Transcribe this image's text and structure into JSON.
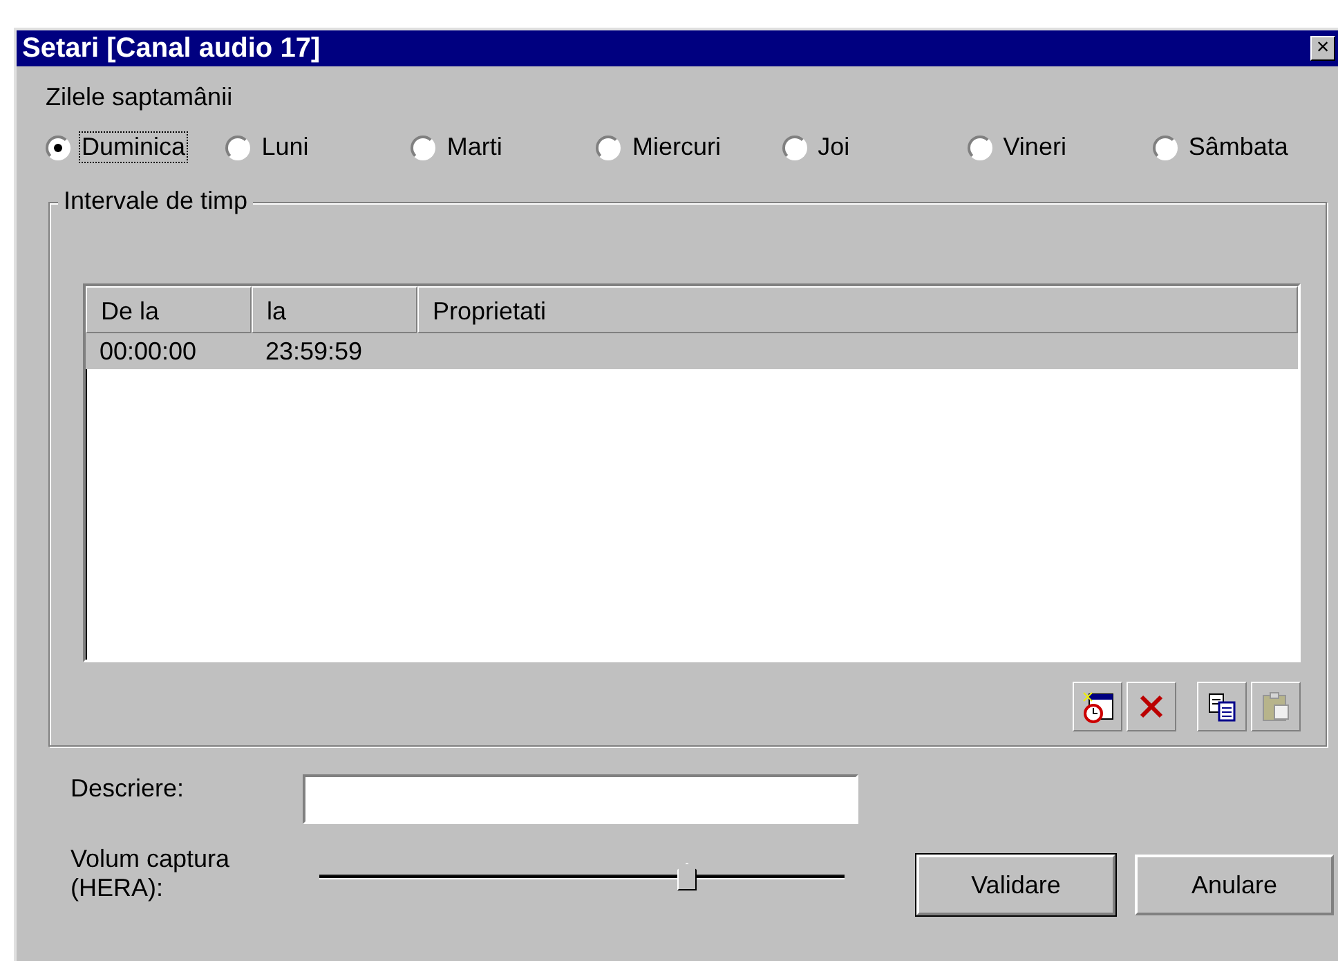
{
  "window": {
    "title": "Setari [Canal audio 17]",
    "close": "×"
  },
  "days": {
    "label": "Zilele saptamânii",
    "options": [
      {
        "label": "Duminica",
        "selected": true
      },
      {
        "label": "Luni",
        "selected": false
      },
      {
        "label": "Marti",
        "selected": false
      },
      {
        "label": "Miercuri",
        "selected": false
      },
      {
        "label": "Joi",
        "selected": false
      },
      {
        "label": "Vineri",
        "selected": false
      },
      {
        "label": "Sâmbata",
        "selected": false
      }
    ]
  },
  "intervals": {
    "title": "Intervale de timp",
    "table": {
      "columns": [
        "De la",
        "la",
        "Proprietati"
      ],
      "rows": [
        {
          "cells": [
            "00:00:00",
            "23:59:59",
            ""
          ],
          "selected": true
        }
      ]
    },
    "toolbar": [
      {
        "kind": "add",
        "disabled": false
      },
      {
        "kind": "delete",
        "disabled": false
      },
      {
        "kind": "copy",
        "disabled": false
      },
      {
        "kind": "paste",
        "disabled": true
      }
    ]
  },
  "description": {
    "label": "Descriere:"
  },
  "volume": {
    "label": "Volum captura (HERA):",
    "level": 0.7
  },
  "buttons": [
    {
      "label": "Validare",
      "default": true
    },
    {
      "label": "Anulare",
      "default": false
    }
  ]
}
